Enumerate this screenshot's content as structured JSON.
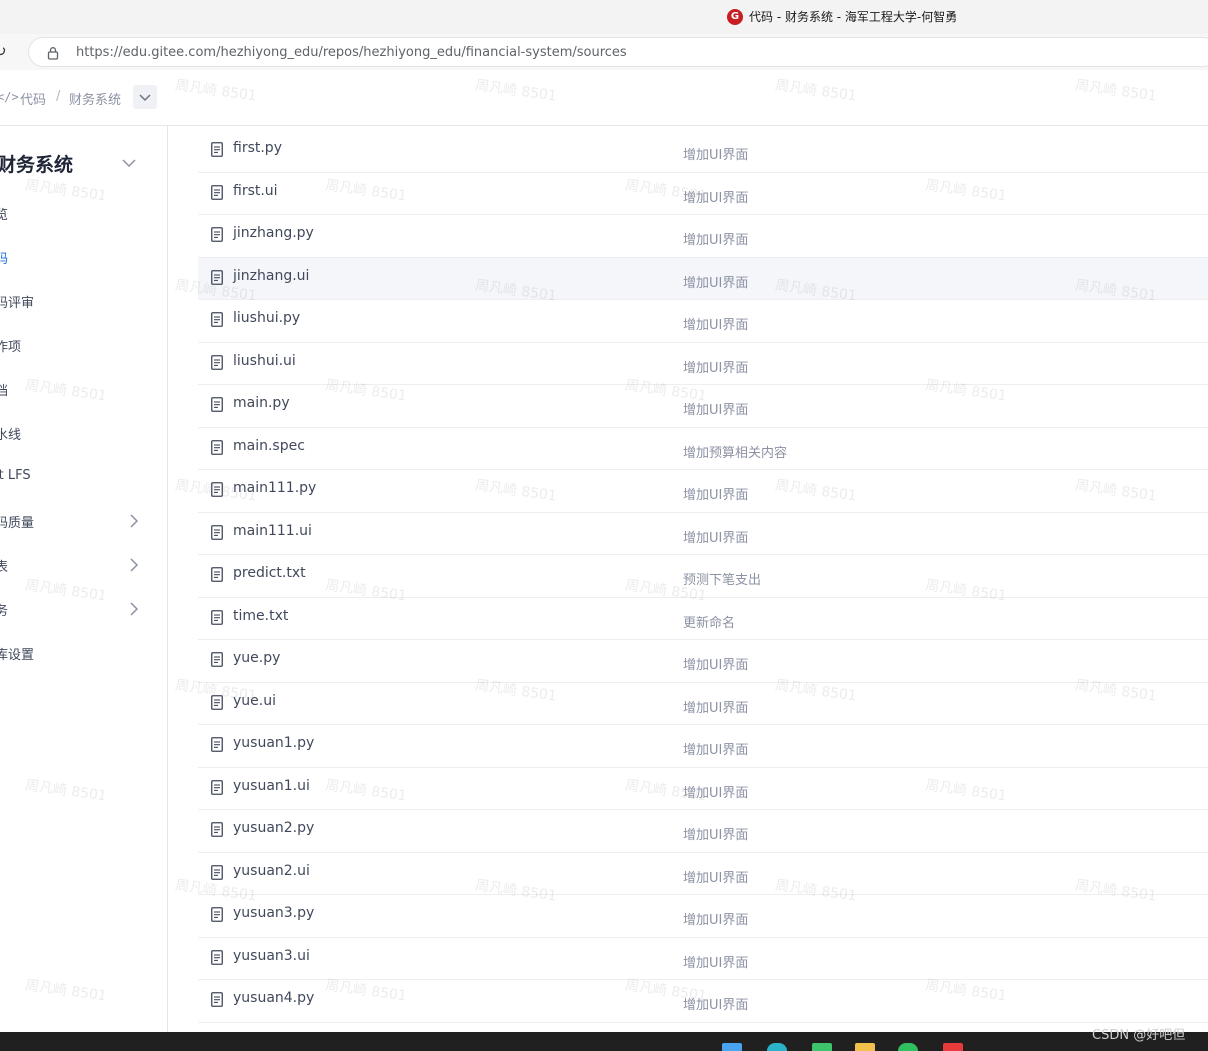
{
  "window": {
    "title": "代码 - 财务系统 - 海军工程大学-何智勇",
    "logo_letter": "G"
  },
  "address_bar": {
    "url": "https://edu.gitee.com/hezhiyong_edu/repos/hezhiyong_edu/financial-system/sources"
  },
  "breadcrumb": {
    "section": "代码",
    "separator": "/",
    "repo": "财务系统"
  },
  "sidebar": {
    "title": "财务系统",
    "items": [
      {
        "label": "览",
        "active": false,
        "expandable": false
      },
      {
        "label": "码",
        "active": true,
        "expandable": false
      },
      {
        "label": "码评审",
        "active": false,
        "expandable": false
      },
      {
        "label": "作项",
        "active": false,
        "expandable": false
      },
      {
        "label": "档",
        "active": false,
        "expandable": false
      },
      {
        "label": "水线",
        "active": false,
        "expandable": false
      },
      {
        "label": "it LFS",
        "active": false,
        "expandable": false
      },
      {
        "label": "码质量",
        "active": false,
        "expandable": true
      },
      {
        "label": "表",
        "active": false,
        "expandable": true
      },
      {
        "label": "务",
        "active": false,
        "expandable": true
      },
      {
        "label": "库设置",
        "active": false,
        "expandable": false
      }
    ]
  },
  "files": [
    {
      "name": "first.py",
      "commit": "增加UI界面"
    },
    {
      "name": "first.ui",
      "commit": "增加UI界面"
    },
    {
      "name": "jinzhang.py",
      "commit": "增加UI界面"
    },
    {
      "name": "jinzhang.ui",
      "commit": "增加UI界面"
    },
    {
      "name": "liushui.py",
      "commit": "增加UI界面"
    },
    {
      "name": "liushui.ui",
      "commit": "增加UI界面"
    },
    {
      "name": "main.py",
      "commit": "增加UI界面"
    },
    {
      "name": "main.spec",
      "commit": "增加预算相关内容"
    },
    {
      "name": "main111.py",
      "commit": "增加UI界面"
    },
    {
      "name": "main111.ui",
      "commit": "增加UI界面"
    },
    {
      "name": "predict.txt",
      "commit": "预测下笔支出"
    },
    {
      "name": "time.txt",
      "commit": "更新命名"
    },
    {
      "name": "yue.py",
      "commit": "增加UI界面"
    },
    {
      "name": "yue.ui",
      "commit": "增加UI界面"
    },
    {
      "name": "yusuan1.py",
      "commit": "增加UI界面"
    },
    {
      "name": "yusuan1.ui",
      "commit": "增加UI界面"
    },
    {
      "name": "yusuan2.py",
      "commit": "增加UI界面"
    },
    {
      "name": "yusuan2.ui",
      "commit": "增加UI界面"
    },
    {
      "name": "yusuan3.py",
      "commit": "增加UI界面"
    },
    {
      "name": "yusuan3.ui",
      "commit": "增加UI界面"
    },
    {
      "name": "yusuan4.py",
      "commit": "增加UI界面"
    }
  ],
  "hovered_row": "jinzhang.ui",
  "watermark": "周凡崎 8501",
  "overlay": {
    "csdn_label": "CSDN @好吧但"
  },
  "colors": {
    "accent": "#1e6fd9",
    "gitee_red": "#c71d23",
    "taskbar": "#202020"
  }
}
